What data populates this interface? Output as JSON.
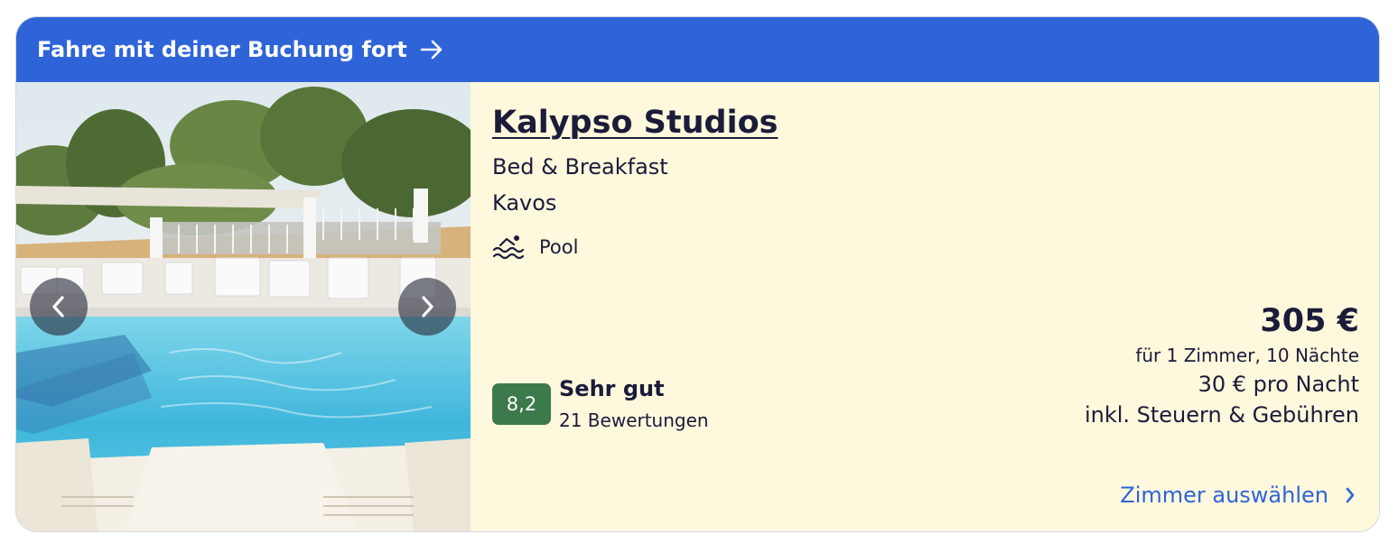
{
  "banner": {
    "label": "Fahre mit deiner Buchung fort",
    "arrow_icon": "arrow-right-icon"
  },
  "hotel": {
    "name": "Kalypso Studios",
    "type": "Bed & Breakfast",
    "location": "Kavos",
    "amenity": {
      "icon": "pool-icon",
      "label": "Pool"
    }
  },
  "rating": {
    "score": "8,2",
    "label": "Sehr gut",
    "count": "21 Bewertungen",
    "color": "#3c7a4b"
  },
  "price": {
    "total": "305 €",
    "stay": "für 1 Zimmer, 10 Nächte",
    "per_night": "30 € pro Nacht",
    "taxes": "inkl. Steuern & Gebühren"
  },
  "cta": {
    "label": "Zimmer auswählen",
    "icon": "chevron-right-icon"
  },
  "gallery": {
    "prev_icon": "chevron-left-icon",
    "next_icon": "chevron-right-icon"
  },
  "colors": {
    "brand": "#2e64d8",
    "card_bg": "#fef8dd",
    "text": "#1b1b3a"
  }
}
